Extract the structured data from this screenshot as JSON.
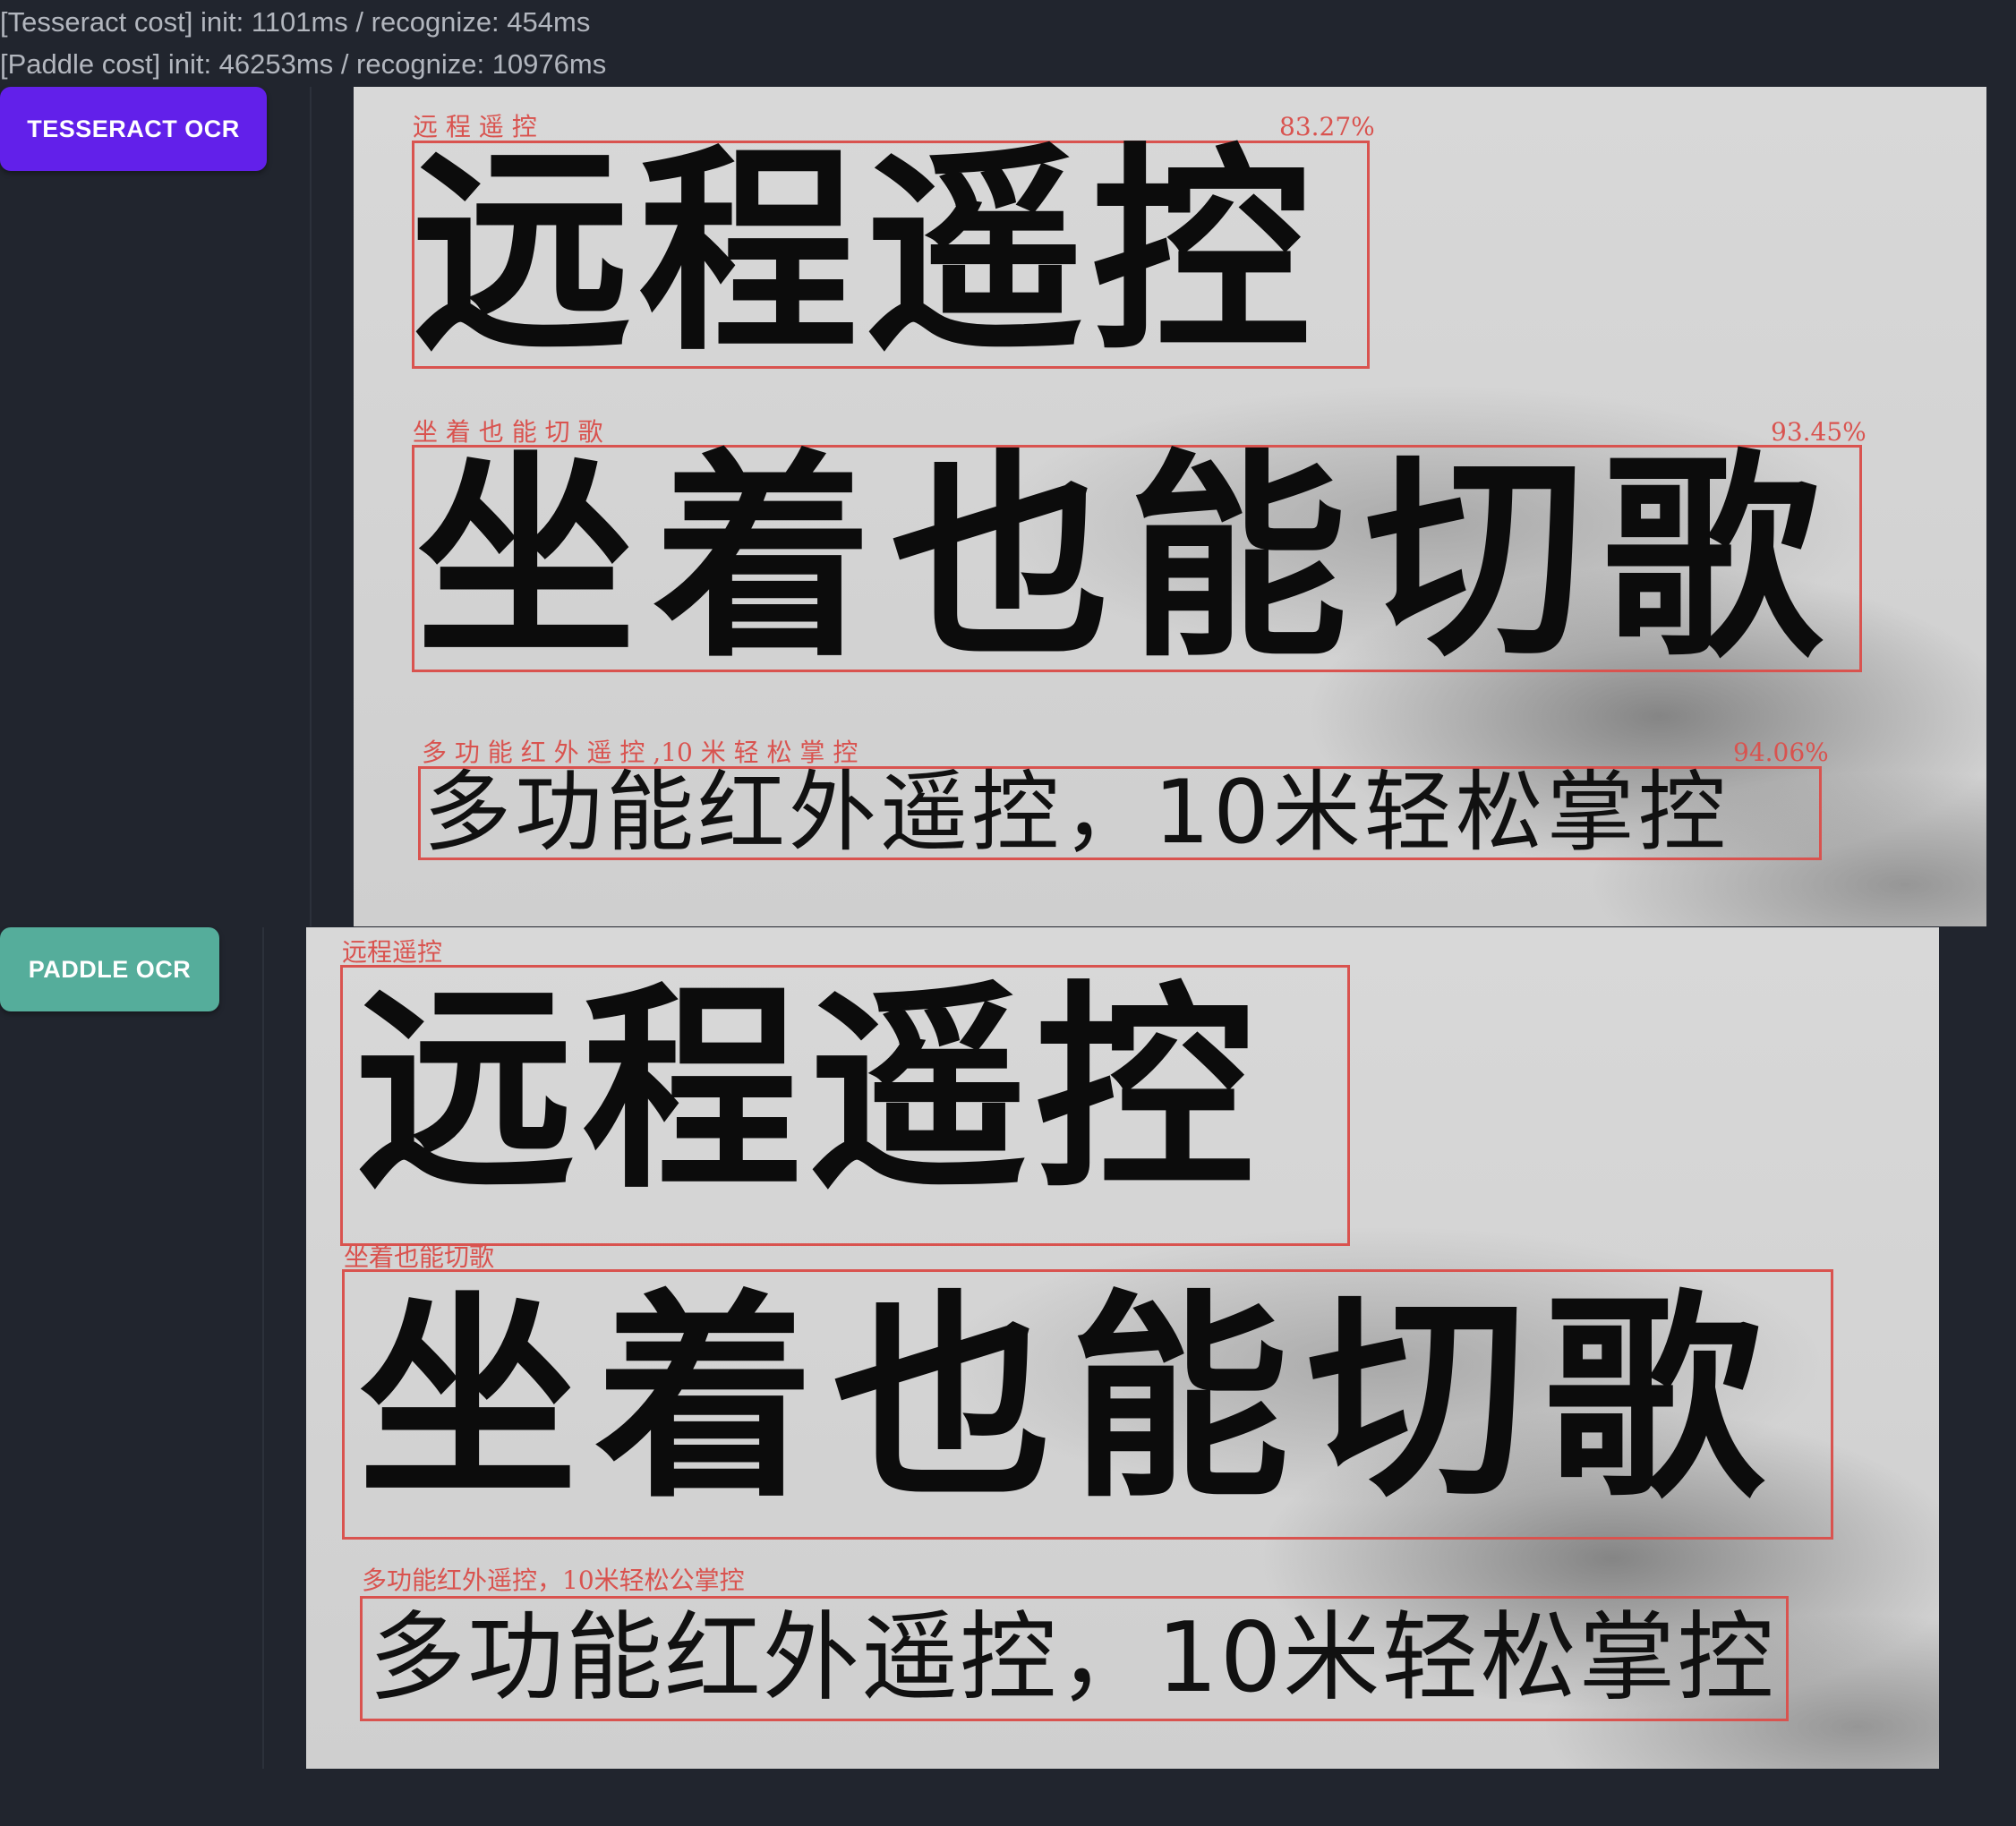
{
  "cost": {
    "tesseract": "[Tesseract cost] init: 1101ms / recognize: 454ms",
    "paddle": "[Paddle cost] init: 46253ms / recognize: 10976ms"
  },
  "buttons": {
    "tesseract": "TESSERACT OCR",
    "paddle": "PADDLE OCR"
  },
  "source_text": {
    "line1": "远程遥控",
    "line2": "坐着也能切歌",
    "line3": "多功能红外遥控，10米轻松掌控"
  },
  "tesseract_results": [
    {
      "label": "远 程 遥 控",
      "confidence": "83.27%"
    },
    {
      "label": "坐 着 也 能 切 歌",
      "confidence": "93.45%"
    },
    {
      "label": "多 功 能 红 外 遥 控 ,10 米 轻 松 掌 控",
      "confidence": "94.06%"
    }
  ],
  "paddle_results": [
    {
      "label": "远程遥控"
    },
    {
      "label": "坐着也能切歌"
    },
    {
      "label": "多功能红外遥控，10米轻松公掌控"
    }
  ],
  "colors": {
    "background": "#21252e",
    "tesseract_button": "#6220ea",
    "paddle_button": "#55ad9b",
    "box": "#d9534f"
  }
}
